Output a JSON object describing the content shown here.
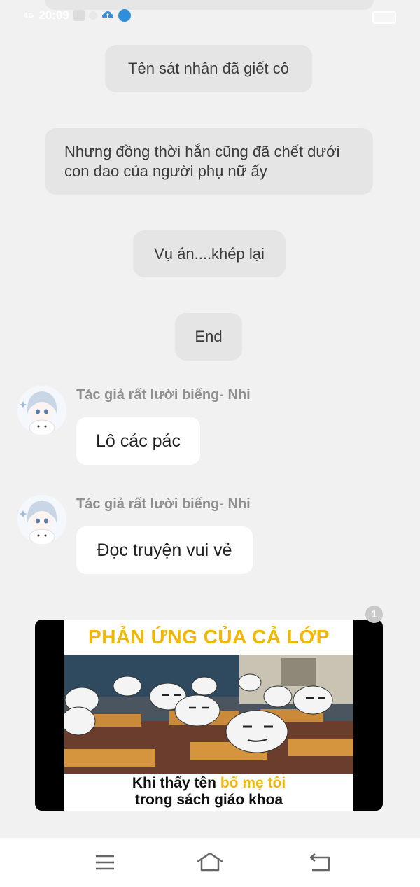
{
  "status_bar": {
    "time": "20:09",
    "signal": "4G"
  },
  "story": {
    "lines": [
      "Tên sát nhân đã giết cô",
      "Nhưng đồng thời hắn cũng đã chết dưới con dao của người phụ nữ ấy",
      "Vụ án....khép lại",
      "End"
    ]
  },
  "messages": [
    {
      "sender": "Tác giả rất lười biếng- Nhi",
      "text": "Lô các pác"
    },
    {
      "sender": "Tác giả rất lười biếng- Nhi",
      "text": "Đọc truyện vui vẻ"
    }
  ],
  "image_message": {
    "headline": "PHẢN ỨNG CỦA CẢ LỚP",
    "caption_line1_prefix": "Khi thấy tên ",
    "caption_line1_highlight": "bố mẹ tôi",
    "caption_line2": "trong sách giáo khoa",
    "badge_count": "1"
  },
  "nav_icons": [
    "menu-icon",
    "home-icon",
    "back-icon"
  ],
  "colors": {
    "background": "#f1f1f1",
    "narration_bubble": "#e5e5e5",
    "message_bubble": "#ffffff",
    "meme_headline": "#f2b705"
  }
}
